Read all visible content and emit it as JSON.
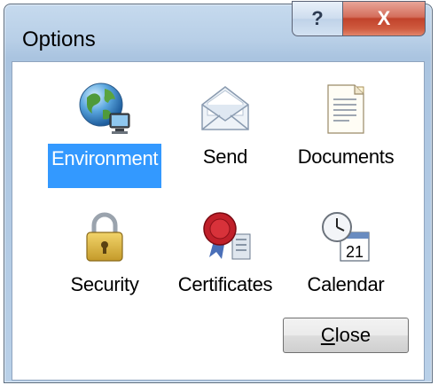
{
  "window": {
    "title": "Options",
    "help_glyph": "?",
    "close_glyph": "X"
  },
  "items": [
    {
      "label": "Environment",
      "icon": "globe-computer-icon",
      "selected": true
    },
    {
      "label": "Send",
      "icon": "envelope-icon",
      "selected": false
    },
    {
      "label": "Documents",
      "icon": "document-icon",
      "selected": false
    },
    {
      "label": "Security",
      "icon": "padlock-icon",
      "selected": false
    },
    {
      "label": "Certificates",
      "icon": "certificate-seal-icon",
      "selected": false
    },
    {
      "label": "Calendar",
      "icon": "calendar-clock-icon",
      "selected": false
    }
  ],
  "close_button": {
    "mnemonic": "C",
    "rest": "lose"
  },
  "colors": {
    "selection": "#3399ff",
    "close_red": "#c1422b",
    "frame": "#b9d0e8"
  }
}
